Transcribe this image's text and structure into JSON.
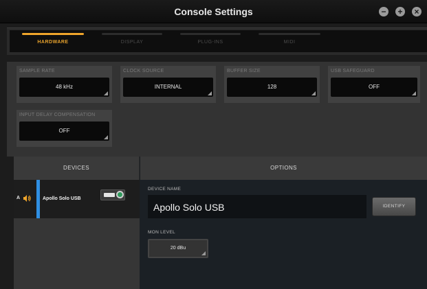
{
  "window": {
    "title": "Console Settings"
  },
  "tabs": [
    {
      "label": "HARDWARE",
      "active": true
    },
    {
      "label": "DISPLAY",
      "active": false
    },
    {
      "label": "PLUG-INS",
      "active": false
    },
    {
      "label": "MIDI",
      "active": false
    }
  ],
  "settings": {
    "sample_rate": {
      "label": "SAMPLE RATE",
      "value": "48 kHz"
    },
    "clock_source": {
      "label": "CLOCK SOURCE",
      "value": "INTERNAL"
    },
    "buffer_size": {
      "label": "BUFFER SIZE",
      "value": "128"
    },
    "usb_safeguard": {
      "label": "USB SAFEGUARD",
      "value": "OFF"
    },
    "input_delay": {
      "label": "INPUT DELAY COMPENSATION",
      "value": "OFF"
    }
  },
  "devices": {
    "header": "DEVICES",
    "items": [
      {
        "letter": "A",
        "name": "Apollo Solo USB"
      }
    ]
  },
  "options": {
    "header": "OPTIONS",
    "device_name_label": "DEVICE NAME",
    "device_name_value": "Apollo Solo USB",
    "identify_label": "IDENTIFY",
    "mon_level_label": "MON LEVEL",
    "mon_level_value": "20 dBu"
  },
  "colors": {
    "accent": "#f0a52b",
    "selection": "#2f8fe3"
  }
}
